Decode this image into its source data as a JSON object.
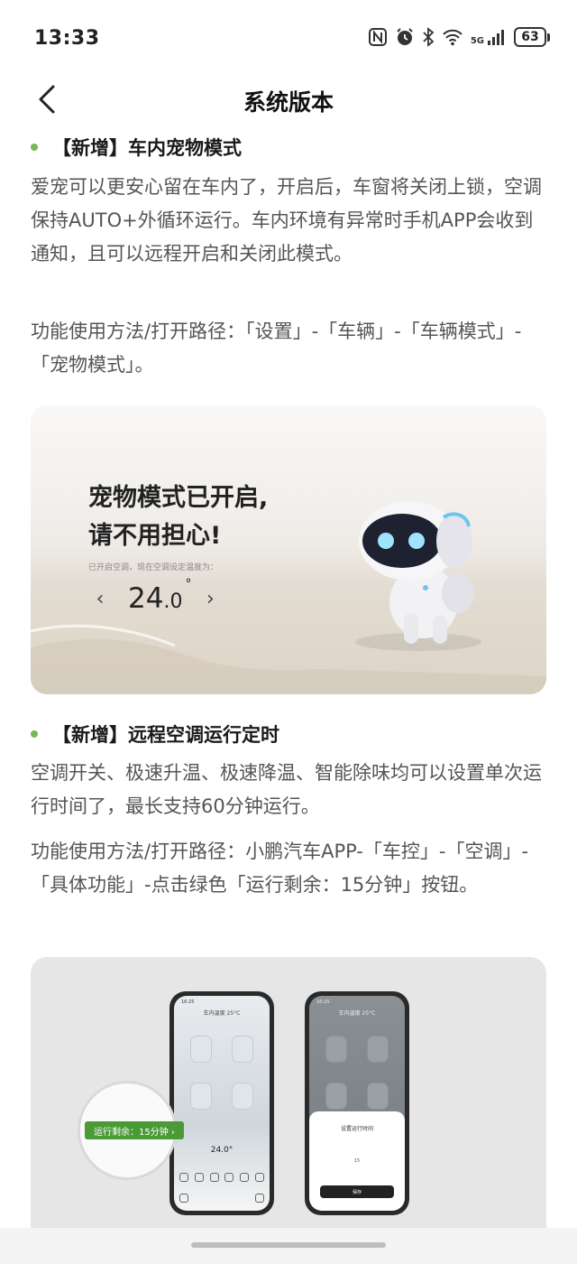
{
  "status_bar": {
    "time": "13:33",
    "battery": "63",
    "network": "5G",
    "icons": [
      "nfc-icon",
      "alarm-icon",
      "bluetooth-icon",
      "wifi-icon",
      "signal-icon",
      "battery-icon"
    ]
  },
  "header": {
    "title": "系统版本",
    "back_icon": "chevron-left-icon"
  },
  "sections": [
    {
      "heading": "【新增】车内宠物模式",
      "description": "爱宠可以更安心留在车内了，开启后，车窗将关闭上锁，空调保持AUTO+外循环运行。车内环境有异常时手机APP会收到通知，且可以远程开启和关闭此模式。",
      "path": "功能使用方法/打开路径：「设置」-「车辆」-「车辆模式」-「宠物模式」。",
      "image": {
        "title_line1": "宠物模式已开启,",
        "title_line2": "请不用担心!",
        "subtext": "已开启空调，现在空调设定温度为：",
        "temp_main": "24",
        "temp_decimal": ".0",
        "temp_degree": "°",
        "arrow_left": "‹",
        "arrow_right": "›"
      }
    },
    {
      "heading": "【新增】远程空调运行定时",
      "description": "空调开关、极速升温、极速降温、智能除味均可以设置单次运行时间了，最长支持60分钟运行。",
      "path": "功能使用方法/打开路径：小鹏汽车APP-「车控」-「空调」-「具体功能」-点击绿色「运行剩余：15分钟」按钮。",
      "image": {
        "phone1_clock": "16:25",
        "phone1_caption": "车内温度 25°C",
        "phone1_temp": "24.0°",
        "remaining_pill": "运行剩余：15分钟 ›",
        "phone2_clock": "16:25",
        "phone2_caption": "车内温度 25°C",
        "sheet_title": "设置运行时间",
        "sheet_value": "15",
        "sheet_button": "保存"
      }
    }
  ],
  "colors": {
    "bullet": "#7bb655",
    "accent_green": "#4a9a36",
    "text_body": "#555555",
    "text_heading": "#1a1a1a"
  }
}
